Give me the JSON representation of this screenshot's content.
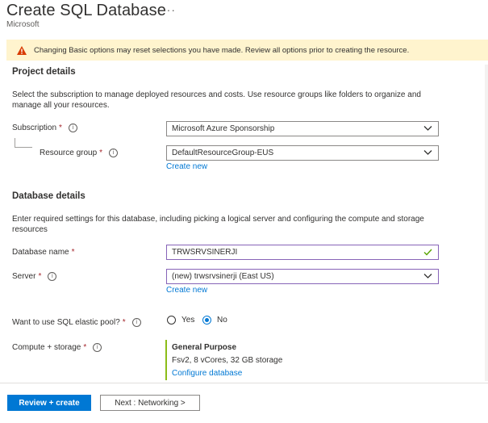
{
  "header": {
    "title": "Create SQL Database",
    "more_label": "···",
    "publisher": "Microsoft"
  },
  "warning": {
    "text": "Changing Basic options may reset selections you have made. Review all options prior to creating the resource."
  },
  "project_details": {
    "heading": "Project details",
    "description": "Select the subscription to manage deployed resources and costs. Use resource groups like folders to organize and manage all your resources.",
    "subscription_label": "Subscription",
    "subscription_value": "Microsoft Azure Sponsorship",
    "resource_group_label": "Resource group",
    "resource_group_value": "DefaultResourceGroup-EUS",
    "create_new_label": "Create new"
  },
  "database_details": {
    "heading": "Database details",
    "description": "Enter required settings for this database, including picking a logical server and configuring the compute and storage resources",
    "db_name_label": "Database name",
    "db_name_value": "TRWSRVSINERJI",
    "server_label": "Server",
    "server_value": "(new) trwsrvsinerji (East US)",
    "server_create_new_label": "Create new",
    "elastic_label": "Want to use SQL elastic pool?",
    "elastic_options": [
      "Yes",
      "No"
    ],
    "elastic_selected": "No",
    "compute_label": "Compute + storage",
    "compute_tier": "General Purpose",
    "compute_spec": "Fsv2, 8 vCores, 32 GB storage",
    "configure_label": "Configure database"
  },
  "footer": {
    "review_button": "Review + create",
    "next_button": "Next : Networking >"
  },
  "colors": {
    "accent": "#0078d4",
    "warning_bg": "#fff4ce",
    "warning_icon": "#d83b01",
    "required": "#a4262c",
    "valid_check": "#57a300",
    "compute_bar": "#8cbd18"
  },
  "required_marker": "*",
  "info_glyph": "i"
}
